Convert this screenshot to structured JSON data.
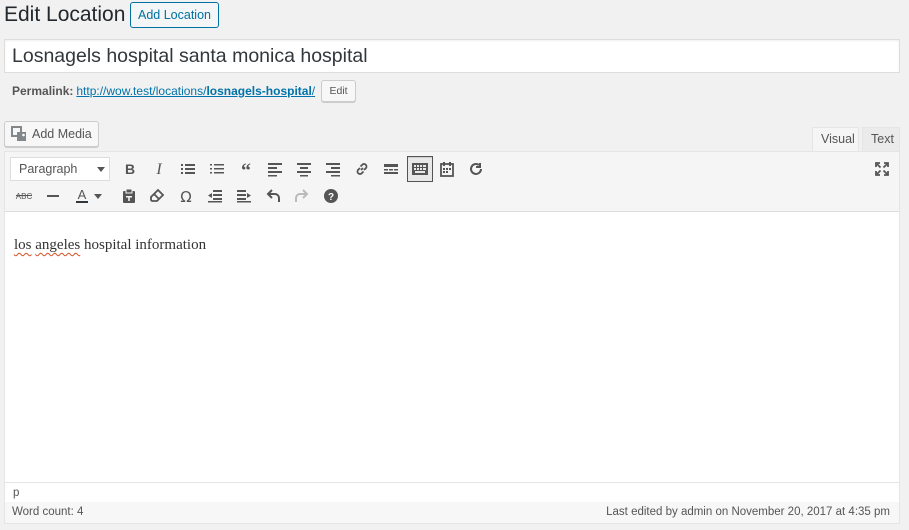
{
  "header": {
    "title": "Edit Location",
    "add_new_label": "Add Location"
  },
  "post": {
    "title_value": "Losnagels hospital santa monica hospital"
  },
  "permalink": {
    "label": "Permalink:",
    "url_prefix": "http://wow.test/locations/",
    "url_slug": "losnagels-hospital",
    "url_suffix": "/",
    "edit_label": "Edit"
  },
  "media": {
    "add_media_label": "Add Media"
  },
  "editor_tabs": {
    "visual": "Visual",
    "text": "Text",
    "active": "visual"
  },
  "toolbar": {
    "format_select_value": "Paragraph",
    "row1_icons": [
      "bold-icon",
      "italic-icon",
      "bullet-list-icon",
      "numbered-list-icon",
      "blockquote-icon",
      "align-left-icon",
      "align-center-icon",
      "align-right-icon",
      "insert-link-icon",
      "read-more-icon",
      "toolbar-toggle-icon",
      "calendar-icon",
      "refresh-icon"
    ],
    "row2_icons": [
      "strikethrough-icon",
      "horizontal-line-icon",
      "text-color-icon",
      "paste-as-text-icon",
      "clear-formatting-icon",
      "special-character-icon",
      "outdent-icon",
      "indent-icon",
      "undo-icon",
      "redo-icon",
      "help-icon"
    ],
    "pressed": "toolbar-toggle-icon"
  },
  "content": {
    "text_words": [
      "los",
      "angeles",
      "hospital information"
    ]
  },
  "path_bar": {
    "text": "p"
  },
  "status": {
    "word_count": "Word count: 4",
    "last_edited": "Last edited by admin on November 20, 2017 at 4:35 pm"
  },
  "colors": {
    "link": "#0073aa",
    "primary_border": "#0071a1",
    "background": "#f1f1f1",
    "spellcheck": "#d54e21"
  }
}
